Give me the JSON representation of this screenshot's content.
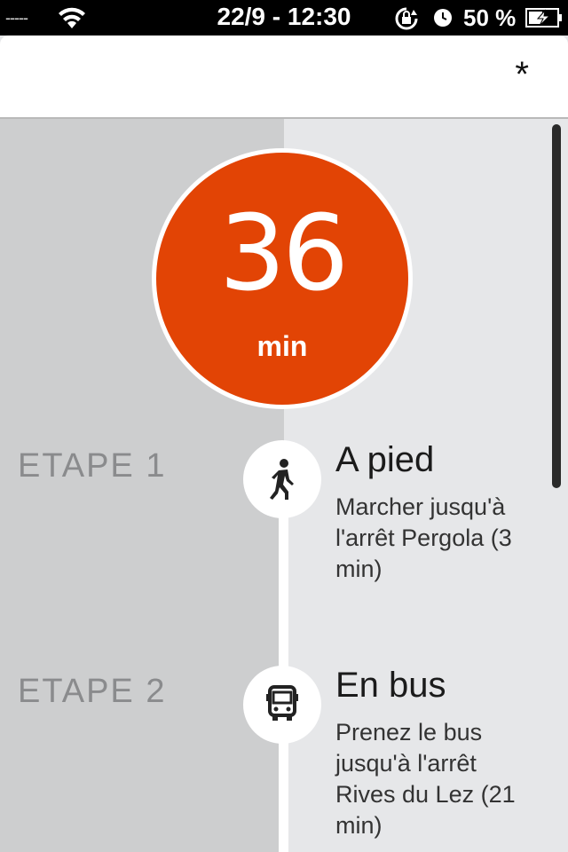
{
  "status_bar": {
    "carrier": "-----",
    "time": "22/9 - 12:30",
    "battery_percent": "50 %"
  },
  "nav": {
    "action_label": "*"
  },
  "summary": {
    "duration_value": "36",
    "duration_unit": "min",
    "accent_color": "#e24405"
  },
  "steps": [
    {
      "label": "ETAPE 1",
      "icon": "walking-person-icon",
      "title": "A pied",
      "description": "Marcher jusqu'à l'arrêt Pergola (3 min)"
    },
    {
      "label": "ETAPE 2",
      "icon": "bus-icon",
      "title": "En bus",
      "description": "Prenez le bus jusqu'à l'arrêt Rives du Lez (21 min)"
    }
  ]
}
